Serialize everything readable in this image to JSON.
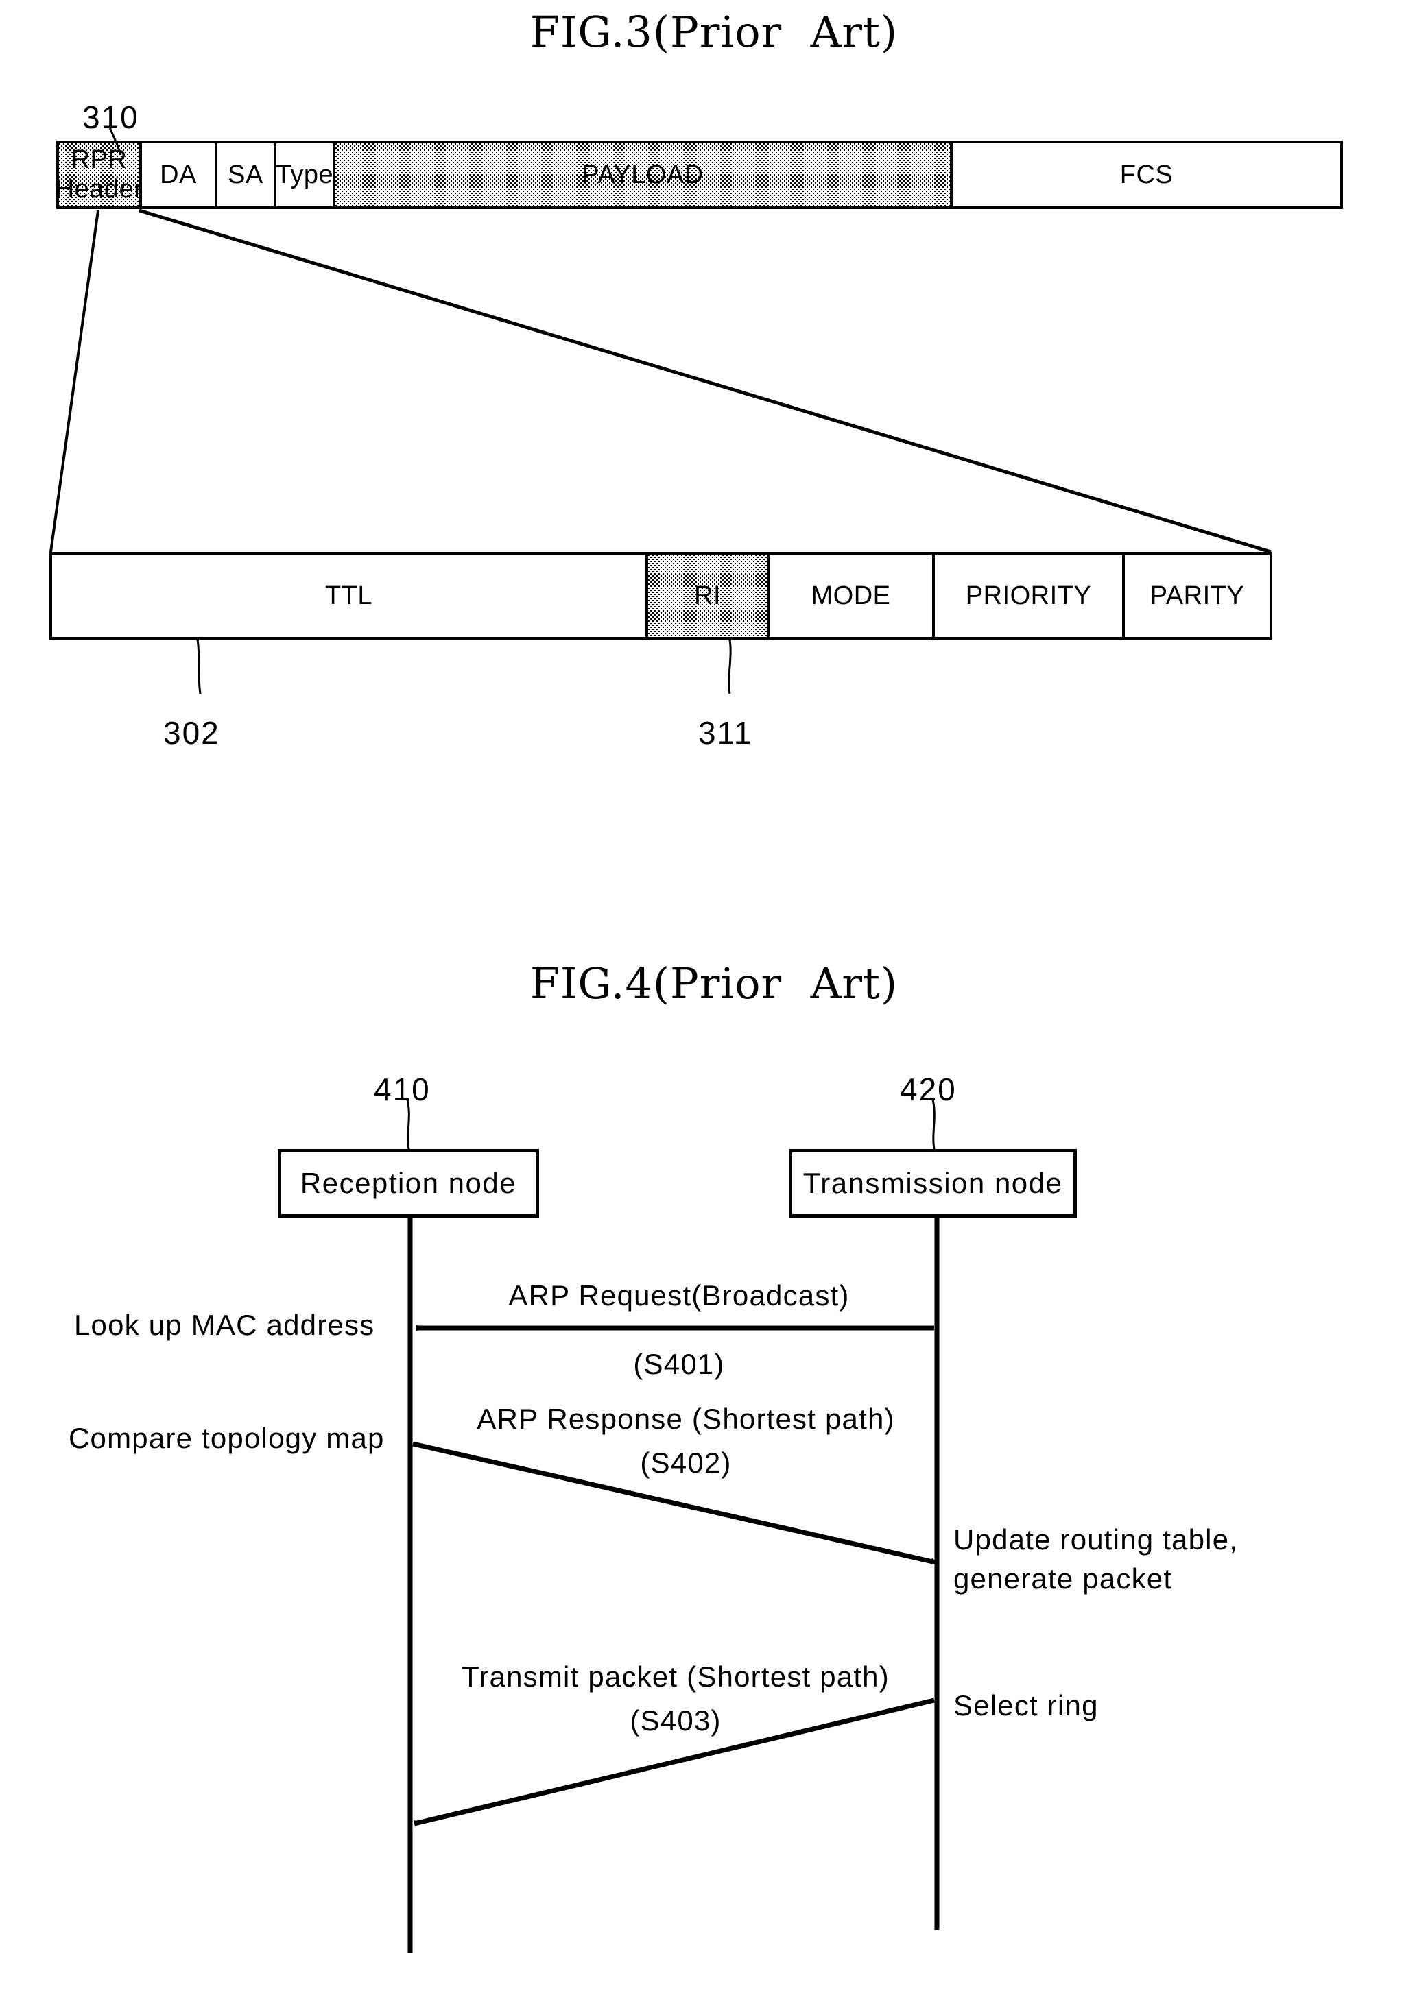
{
  "figures": {
    "fig3": {
      "title": "FIG.3(Prior  Art)",
      "refs": {
        "rpr_header": "310",
        "header_detail": "302",
        "ri_field": "311"
      },
      "packet_fields": [
        {
          "label": "RPR\nHeader",
          "shaded": true
        },
        {
          "label": "DA",
          "shaded": false
        },
        {
          "label": "SA",
          "shaded": false
        },
        {
          "label": "Type",
          "shaded": false
        },
        {
          "label": "PAYLOAD",
          "shaded": true
        },
        {
          "label": "FCS",
          "shaded": false
        }
      ],
      "header_fields": [
        {
          "label": "TTL",
          "shaded": false
        },
        {
          "label": "RI",
          "shaded": true
        },
        {
          "label": "MODE",
          "shaded": false
        },
        {
          "label": "PRIORITY",
          "shaded": false
        },
        {
          "label": "PARITY",
          "shaded": false
        }
      ]
    },
    "fig4": {
      "title": "FIG.4(Prior  Art)",
      "nodes": [
        {
          "label": "Reception node",
          "ref": "410"
        },
        {
          "label": "Transmission node",
          "ref": "420"
        }
      ],
      "messages": [
        {
          "label": "ARP  Request(Broadcast)",
          "step": "(S401)",
          "direction": "right-to-left"
        },
        {
          "label": "ARP  Response (Shortest  path)",
          "step": "(S402)",
          "direction": "left-to-right"
        },
        {
          "label": "Transmit  packet (Shortest  path)",
          "step": "(S403)",
          "direction": "right-to-left"
        }
      ],
      "annotations": [
        {
          "text": "Look  up  MAC  address",
          "side": "left"
        },
        {
          "text": "Compare  topology  map",
          "side": "left"
        },
        {
          "text": "Update  routing  table,\ngenerate  packet",
          "side": "right"
        },
        {
          "text": "Select  ring",
          "side": "right"
        }
      ]
    }
  },
  "colors": {
    "ink": "#000000",
    "paper": "#ffffff"
  }
}
